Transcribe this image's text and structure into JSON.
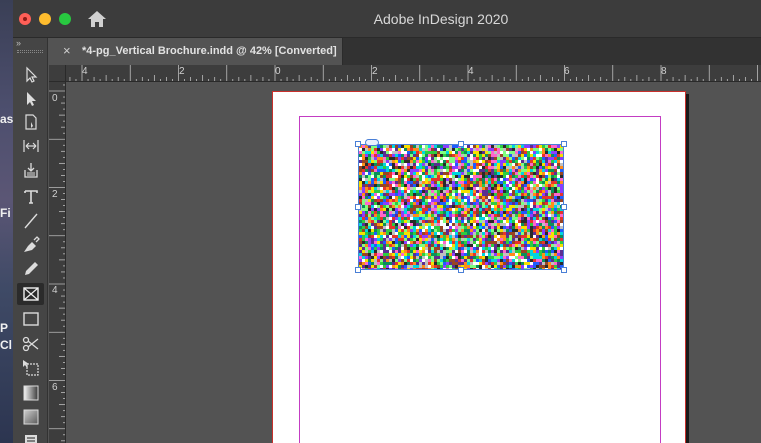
{
  "desktop": {
    "fragments": [
      "as",
      "Fi",
      "P",
      "Cl"
    ]
  },
  "window": {
    "title": "Adobe InDesign 2020"
  },
  "tools_panel": {
    "collapse_glyph": "››",
    "tools": [
      {
        "name": "selection-tool-icon",
        "active": false
      },
      {
        "name": "direct-selection-tool-icon",
        "active": false
      },
      {
        "name": "page-tool-icon",
        "active": false
      },
      {
        "name": "gap-tool-icon",
        "active": false
      },
      {
        "name": "content-collector-icon",
        "active": false
      },
      {
        "name": "type-tool-icon",
        "active": false
      },
      {
        "name": "line-tool-icon",
        "active": false
      },
      {
        "name": "pen-tool-icon",
        "active": false
      },
      {
        "name": "pencil-tool-icon",
        "active": false
      },
      {
        "name": "rectangle-frame-tool-icon",
        "active": true
      },
      {
        "name": "rectangle-tool-icon",
        "active": false
      },
      {
        "name": "scissors-tool-icon",
        "active": false
      },
      {
        "name": "free-transform-tool-icon",
        "active": false
      },
      {
        "name": "gradient-swatch-tool-icon",
        "active": false
      },
      {
        "name": "gradient-feather-tool-icon",
        "active": false
      },
      {
        "name": "note-tool-icon",
        "active": false
      }
    ]
  },
  "document_tab": {
    "close_glyph": "×",
    "title": "*4-pg_Vertical Brochure.indd @ 42% [Converted]"
  },
  "ruler_horizontal": {
    "labels": [
      "4",
      "2",
      "0",
      "2",
      "4",
      "6",
      "8"
    ]
  },
  "ruler_vertical": {
    "labels": [
      "0",
      "2",
      "4",
      "6"
    ]
  },
  "colors": {
    "page_border": "#c8302c",
    "margin_guide": "#c33cc3",
    "frame_selection": "#4a7fd6",
    "pasteboard": "#535353"
  }
}
